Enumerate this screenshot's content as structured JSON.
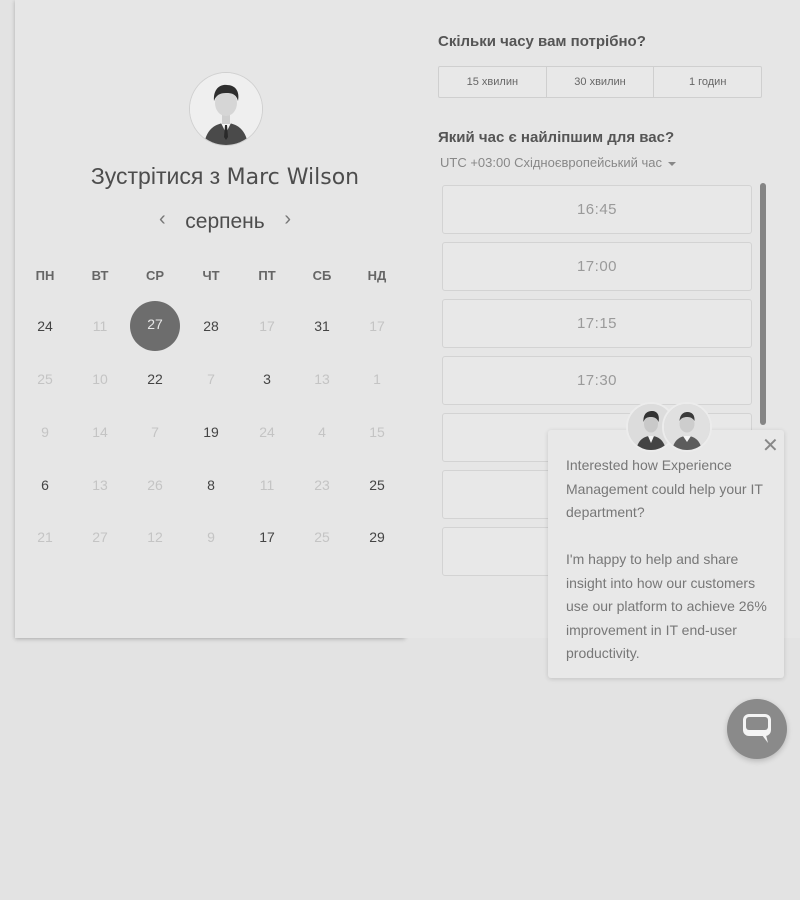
{
  "profile": {
    "title_prefix": "Зустрітися з",
    "host_name": "Marc Wilson"
  },
  "calendar": {
    "month": "серпень",
    "weekdays": [
      "ПН",
      "ВТ",
      "СР",
      "ЧТ",
      "ПТ",
      "СБ",
      "НД"
    ],
    "weeks": [
      [
        {
          "d": "24",
          "s": "active"
        },
        {
          "d": "11",
          "s": "dim"
        },
        {
          "d": "27",
          "s": "selected"
        },
        {
          "d": "28",
          "s": "active"
        },
        {
          "d": "17",
          "s": "dim"
        },
        {
          "d": "31",
          "s": "active"
        },
        {
          "d": "17",
          "s": "dim"
        }
      ],
      [
        {
          "d": "25",
          "s": "dim"
        },
        {
          "d": "10",
          "s": "dim"
        },
        {
          "d": "22",
          "s": "active"
        },
        {
          "d": "7",
          "s": "dim"
        },
        {
          "d": "3",
          "s": "active"
        },
        {
          "d": "13",
          "s": "dim"
        },
        {
          "d": "1",
          "s": "dim"
        }
      ],
      [
        {
          "d": "9",
          "s": "dim"
        },
        {
          "d": "14",
          "s": "dim"
        },
        {
          "d": "7",
          "s": "dim"
        },
        {
          "d": "19",
          "s": "active"
        },
        {
          "d": "24",
          "s": "dim"
        },
        {
          "d": "4",
          "s": "dim"
        },
        {
          "d": "15",
          "s": "dim"
        }
      ],
      [
        {
          "d": "6",
          "s": "active"
        },
        {
          "d": "13",
          "s": "dim"
        },
        {
          "d": "26",
          "s": "dim"
        },
        {
          "d": "8",
          "s": "active"
        },
        {
          "d": "11",
          "s": "dim"
        },
        {
          "d": "23",
          "s": "dim"
        },
        {
          "d": "25",
          "s": "active"
        }
      ],
      [
        {
          "d": "21",
          "s": "dim"
        },
        {
          "d": "27",
          "s": "dim"
        },
        {
          "d": "12",
          "s": "dim"
        },
        {
          "d": "9",
          "s": "dim"
        },
        {
          "d": "17",
          "s": "active"
        },
        {
          "d": "25",
          "s": "dim"
        },
        {
          "d": "29",
          "s": "active"
        }
      ]
    ]
  },
  "duration": {
    "question": "Скільки часу вам потрібно?",
    "options": [
      "15 хвилин",
      "30 хвилин",
      "1 годин"
    ]
  },
  "time": {
    "question": "Який час є найліпшим для вас?",
    "timezone": "UTC +03:00 Східноєвропейський час",
    "slots": [
      "16:45",
      "17:00",
      "17:15",
      "17:30",
      "",
      "",
      ""
    ]
  },
  "popup": {
    "paragraph_1": "Interested how Experience Management could help your IT department?",
    "paragraph_2": "I'm happy to help and share insight into how our customers use our platform to achieve 26% improvement in IT end-user productivity."
  },
  "icons": {
    "close": "close-icon",
    "prev": "chevron-left-icon",
    "next": "chevron-right-icon",
    "chat": "chat-bubble-icon"
  }
}
